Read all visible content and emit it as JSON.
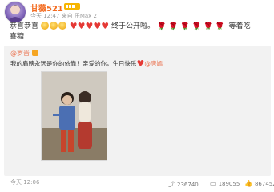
{
  "user": {
    "name": "甘薇521",
    "meta": "今天 12:47 来自 乐Max 2"
  },
  "post": {
    "prefix": "恭喜恭喜",
    "middle": "终于公开啦。",
    "suffix_1": "等着吃",
    "suffix_2": "喜糖",
    "smile_count": 3,
    "heart_count": 5,
    "rose_count": 6
  },
  "repost": {
    "author": "@罗晋",
    "text_main": "我的肩膀永远是你的依靠！亲爱的你，生日快乐",
    "mention": "@唐嫣",
    "time": "今天 12:06"
  },
  "stats": {
    "share": "236740",
    "comment": "189055",
    "like": "867452"
  },
  "colors": {
    "accent": "#eb7350",
    "name": "#f36c21",
    "heart": "#e53935"
  }
}
